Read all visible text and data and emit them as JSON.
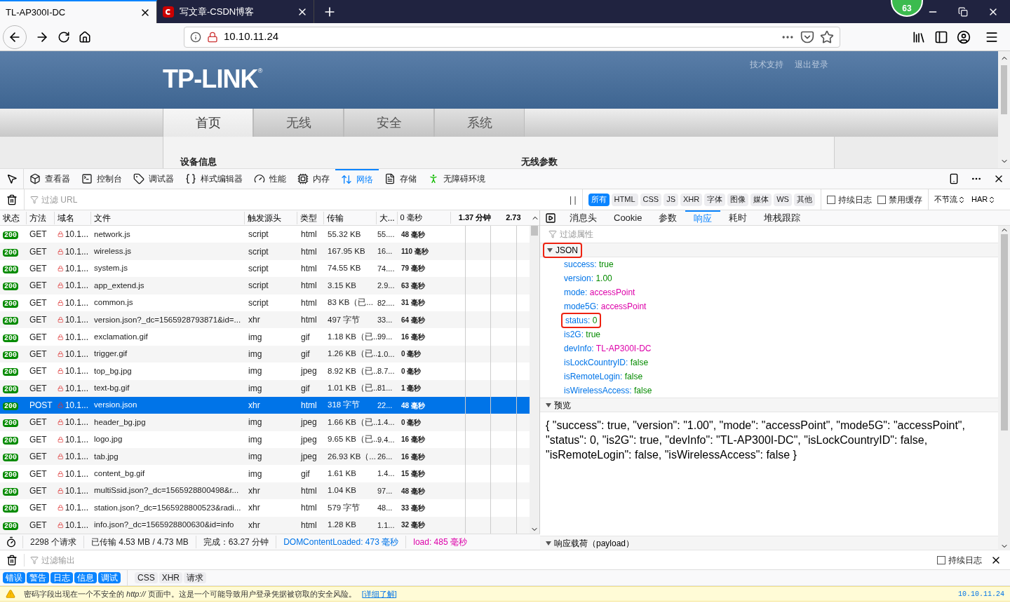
{
  "browser": {
    "tabs": [
      {
        "title": "TL-AP300I-DC",
        "selected": true,
        "kind": "page"
      },
      {
        "title": "写文章-CSDN博客",
        "selected": false,
        "kind": "csdn"
      }
    ],
    "badge": "63",
    "url": "10.10.11.24"
  },
  "page": {
    "logo": "TP-LINK",
    "logo_mark": "®",
    "header_links": [
      "技术支持",
      "退出登录"
    ],
    "nav": [
      {
        "label": "首页",
        "selected": true
      },
      {
        "label": "无线",
        "selected": false
      },
      {
        "label": "安全",
        "selected": false
      },
      {
        "label": "系统",
        "selected": false
      }
    ],
    "sections": [
      "设备信息",
      "无线参数"
    ]
  },
  "devtools": {
    "tools": [
      {
        "label": "查看器",
        "selected": false
      },
      {
        "label": "控制台",
        "selected": false
      },
      {
        "label": "调试器",
        "selected": false
      },
      {
        "label": "样式编辑器",
        "selected": false
      },
      {
        "label": "性能",
        "selected": false
      },
      {
        "label": "内存",
        "selected": false
      },
      {
        "label": "网络",
        "selected": true
      },
      {
        "label": "存储",
        "selected": false
      },
      {
        "label": "无障碍环境",
        "selected": false
      }
    ],
    "filter_placeholder": "过滤 URL",
    "pause": "| |",
    "type_filters": [
      {
        "label": "所有",
        "selected": true
      },
      {
        "label": "HTML",
        "selected": false
      },
      {
        "label": "CSS",
        "selected": false
      },
      {
        "label": "JS",
        "selected": false
      },
      {
        "label": "XHR",
        "selected": false
      },
      {
        "label": "字体",
        "selected": false
      },
      {
        "label": "图像",
        "selected": false
      },
      {
        "label": "媒体",
        "selected": false
      },
      {
        "label": "WS",
        "selected": false
      },
      {
        "label": "其他",
        "selected": false
      }
    ],
    "options": [
      {
        "label": "持续日志",
        "checked": false
      },
      {
        "label": "禁用缓存",
        "checked": false
      }
    ],
    "selects": [
      "不节流",
      "HAR"
    ],
    "table": {
      "columns": [
        "状态",
        "方法",
        "域名",
        "文件",
        "触发源头",
        "类型",
        "传输",
        "大...",
        "0 毫秒"
      ],
      "timeline_ticks": [
        "1.37 分钟",
        "2.73"
      ],
      "rows": [
        {
          "status": "200",
          "method": "GET",
          "domain": "10.1...",
          "file": "network.js",
          "cause": "script",
          "type": "html",
          "transferred": "55.32 KB",
          "size": "55....",
          "time": "48 毫秒",
          "selected": false
        },
        {
          "status": "200",
          "method": "GET",
          "domain": "10.1...",
          "file": "wireless.js",
          "cause": "script",
          "type": "html",
          "transferred": "167.95 KB",
          "size": "16...",
          "time": "110 毫秒",
          "selected": false
        },
        {
          "status": "200",
          "method": "GET",
          "domain": "10.1...",
          "file": "system.js",
          "cause": "script",
          "type": "html",
          "transferred": "74.55 KB",
          "size": "74....",
          "time": "79 毫秒",
          "selected": false
        },
        {
          "status": "200",
          "method": "GET",
          "domain": "10.1...",
          "file": "app_extend.js",
          "cause": "script",
          "type": "html",
          "transferred": "3.15 KB",
          "size": "2.9...",
          "time": "63 毫秒",
          "selected": false
        },
        {
          "status": "200",
          "method": "GET",
          "domain": "10.1...",
          "file": "common.js",
          "cause": "script",
          "type": "html",
          "transferred": "83 KB（已...",
          "size": "82....",
          "time": "31 毫秒",
          "selected": false
        },
        {
          "status": "200",
          "method": "GET",
          "domain": "10.1...",
          "file": "version.json?_dc=1565928793871&id=...",
          "cause": "xhr",
          "type": "html",
          "transferred": "497 字节",
          "size": "33...",
          "time": "64 毫秒",
          "selected": false
        },
        {
          "status": "200",
          "method": "GET",
          "domain": "10.1...",
          "file": "exclamation.gif",
          "cause": "img",
          "type": "gif",
          "transferred": "1.18 KB（已...",
          "size": "99...",
          "time": "16 毫秒",
          "selected": false
        },
        {
          "status": "200",
          "method": "GET",
          "domain": "10.1...",
          "file": "trigger.gif",
          "cause": "img",
          "type": "gif",
          "transferred": "1.26 KB（已...",
          "size": "1.0...",
          "time": "0 毫秒",
          "selected": false
        },
        {
          "status": "200",
          "method": "GET",
          "domain": "10.1...",
          "file": "top_bg.jpg",
          "cause": "img",
          "type": "jpeg",
          "transferred": "8.92 KB（已...",
          "size": "8.7...",
          "time": "0 毫秒",
          "selected": false
        },
        {
          "status": "200",
          "method": "GET",
          "domain": "10.1...",
          "file": "text-bg.gif",
          "cause": "img",
          "type": "gif",
          "transferred": "1.01 KB（已...",
          "size": "81...",
          "time": "1 毫秒",
          "selected": false
        },
        {
          "status": "200",
          "method": "POST",
          "domain": "10.1...",
          "file": "version.json",
          "cause": "xhr",
          "type": "html",
          "transferred": "318 字节",
          "size": "22...",
          "time": "48 毫秒",
          "selected": true
        },
        {
          "status": "200",
          "method": "GET",
          "domain": "10.1...",
          "file": "header_bg.jpg",
          "cause": "img",
          "type": "jpeg",
          "transferred": "1.66 KB（已...",
          "size": "1.4...",
          "time": "0 毫秒",
          "selected": false
        },
        {
          "status": "200",
          "method": "GET",
          "domain": "10.1...",
          "file": "logo.jpg",
          "cause": "img",
          "type": "jpeg",
          "transferred": "9.65 KB（已...",
          "size": "9.4...",
          "time": "16 毫秒",
          "selected": false
        },
        {
          "status": "200",
          "method": "GET",
          "domain": "10.1...",
          "file": "tab.jpg",
          "cause": "img",
          "type": "jpeg",
          "transferred": "26.93 KB（...",
          "size": "26...",
          "time": "16 毫秒",
          "selected": false
        },
        {
          "status": "200",
          "method": "GET",
          "domain": "10.1...",
          "file": "content_bg.gif",
          "cause": "img",
          "type": "gif",
          "transferred": "1.61 KB",
          "size": "1.4...",
          "time": "15 毫秒",
          "selected": false
        },
        {
          "status": "200",
          "method": "GET",
          "domain": "10.1...",
          "file": "multiSsid.json?_dc=1565928800498&r...",
          "cause": "xhr",
          "type": "html",
          "transferred": "1.04 KB",
          "size": "97...",
          "time": "48 毫秒",
          "selected": false
        },
        {
          "status": "200",
          "method": "GET",
          "domain": "10.1...",
          "file": "station.json?_dc=1565928800523&radi...",
          "cause": "xhr",
          "type": "html",
          "transferred": "579 字节",
          "size": "48...",
          "time": "33 毫秒",
          "selected": false
        },
        {
          "status": "200",
          "method": "GET",
          "domain": "10.1...",
          "file": "info.json?_dc=1565928800630&id=info",
          "cause": "xhr",
          "type": "html",
          "transferred": "1.28 KB",
          "size": "1.1...",
          "time": "32 毫秒",
          "selected": false
        }
      ]
    },
    "details": {
      "tabs": [
        {
          "label": "消息头",
          "selected": false
        },
        {
          "label": "Cookie",
          "selected": false
        },
        {
          "label": "参数",
          "selected": false
        },
        {
          "label": "响应",
          "selected": true
        },
        {
          "label": "耗时",
          "selected": false
        },
        {
          "label": "堆栈跟踪",
          "selected": false
        }
      ],
      "filter_placeholder": "过滤属性",
      "json": {
        "title": "JSON",
        "expanded": true,
        "highlighted": true,
        "items": [
          {
            "key": "success:",
            "value": "true",
            "kind": "literal",
            "highlighted": false
          },
          {
            "key": "version:",
            "value": "1.00",
            "kind": "literal",
            "highlighted": false
          },
          {
            "key": "mode:",
            "value": "accessPoint",
            "kind": "string",
            "highlighted": false
          },
          {
            "key": "mode5G:",
            "value": "accessPoint",
            "kind": "string",
            "highlighted": false
          },
          {
            "key": "status:",
            "value": "0",
            "kind": "literal",
            "highlighted": true
          },
          {
            "key": "is2G:",
            "value": "true",
            "kind": "literal",
            "highlighted": false
          },
          {
            "key": "devInfo:",
            "value": "TL-AP300I-DC",
            "kind": "string",
            "highlighted": false
          },
          {
            "key": "isLockCountryID:",
            "value": "false",
            "kind": "literal",
            "highlighted": false
          },
          {
            "key": "isRemoteLogin:",
            "value": "false",
            "kind": "literal",
            "highlighted": false
          },
          {
            "key": "isWirelessAccess:",
            "value": "false",
            "kind": "literal",
            "highlighted": false
          }
        ]
      },
      "preview": {
        "title": "预览",
        "expanded": true,
        "text": "{ \"success\": true, \"version\": \"1.00\", \"mode\": \"accessPoint\", \"mode5G\": \"accessPoint\", \"status\": 0, \"is2G\": true, \"devInfo\": \"TL-AP300I-DC\", \"isLockCountryID\": false, \"isRemoteLogin\": false, \"isWirelessAccess\": false }"
      },
      "payload": {
        "title": "响应载荷（payload）",
        "expanded": true
      }
    },
    "status_bar": [
      {
        "text": "2298 个请求",
        "kind": "plain"
      },
      {
        "text": "已传输 4.53 MB / 4.73 MB",
        "kind": "plain"
      },
      {
        "text": "完成：63.27 分钟",
        "kind": "plain"
      },
      {
        "text": "DOMContentLoaded: 473 毫秒",
        "kind": "dom"
      },
      {
        "text": "load: 485 毫秒",
        "kind": "load"
      }
    ]
  },
  "console": {
    "filter_placeholder": "过滤输出",
    "persist": {
      "label": "持续日志",
      "checked": false
    },
    "levels": [
      {
        "label": "错误",
        "selected": true
      },
      {
        "label": "警告",
        "selected": true
      },
      {
        "label": "日志",
        "selected": true
      },
      {
        "label": "信息",
        "selected": true
      },
      {
        "label": "调试",
        "selected": true
      }
    ],
    "requests": [
      {
        "label": "CSS",
        "selected": false
      },
      {
        "label": "XHR",
        "selected": false
      },
      {
        "label": "请求",
        "selected": false
      }
    ],
    "message": {
      "text": "密码字段出现在一个不安全的 *http://* 页面中。这是一个可能导致用户登录凭据被窃取的安全风险。",
      "link": "[详细了解]",
      "source": "10.10.11.24"
    }
  }
}
